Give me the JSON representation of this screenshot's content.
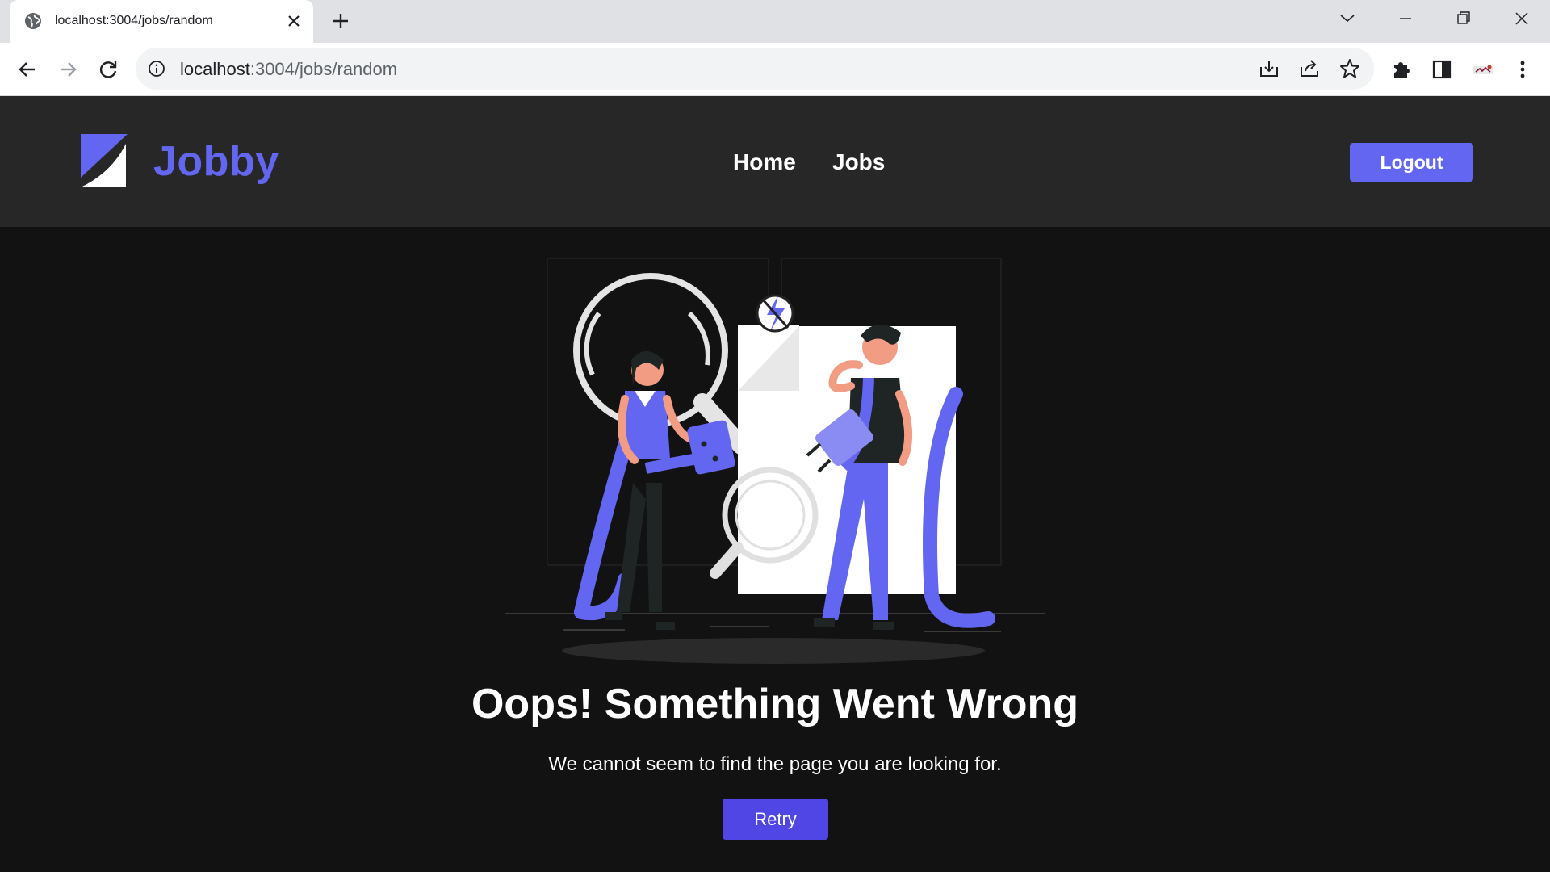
{
  "browser": {
    "tab_title": "localhost:3004/jobs/random",
    "url_host": "localhost",
    "url_path": ":3004/jobs/random"
  },
  "header": {
    "logo_text": "Jobby",
    "nav": [
      {
        "label": "Home"
      },
      {
        "label": "Jobs"
      }
    ],
    "logout_label": "Logout"
  },
  "error": {
    "title": "Oops! Something Went Wrong",
    "description": "We cannot seem to find the page you are looking for.",
    "retry_label": "Retry"
  },
  "icons": {
    "tab_favicon": "globe-icon",
    "tab_close": "close-icon",
    "new_tab": "plus-icon",
    "back": "arrow-left-icon",
    "forward": "arrow-right-icon",
    "reload": "reload-icon",
    "site_info": "info-icon",
    "install": "download-icon",
    "share": "share-icon",
    "bookmark": "star-icon",
    "extensions": "puzzle-icon",
    "side_panel": "side-panel-icon",
    "profile": "profile-avatar",
    "menu": "kebab-menu-icon"
  },
  "colors": {
    "brand": "#6366f1",
    "retry_button": "#4f46e5",
    "header_bg": "#272727",
    "page_bg": "#121212"
  }
}
